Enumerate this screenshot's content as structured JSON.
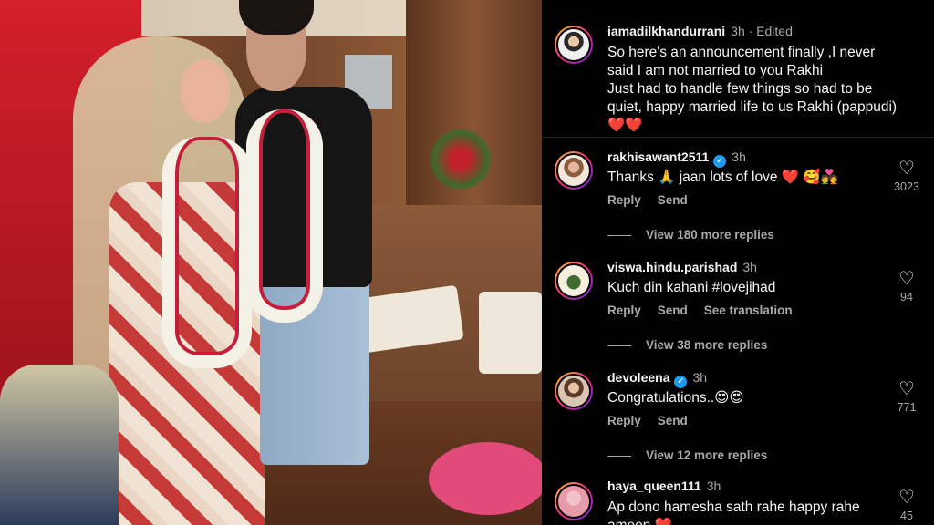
{
  "caption": {
    "username": "iamadilkhandurrani",
    "time": "3h · Edited",
    "text": "So here's an announcement finally ,I never said I am not married to you Rakhi\nJust had to handle few things so had to be quiet, happy married life to us Rakhi (pappudi) ❤️❤️"
  },
  "comments": [
    {
      "username": "rakhisawant2511",
      "verified": true,
      "time": "3h",
      "text": "Thanks 🙏 jaan lots of love ❤️ 🥰💑",
      "reply": "Reply",
      "send": "Send",
      "likes": "3023",
      "more_replies": "View 180 more replies"
    },
    {
      "username": "viswa.hindu.parishad",
      "verified": false,
      "time": "3h",
      "text": "Kuch din kahani #lovejihad",
      "reply": "Reply",
      "send": "Send",
      "translation": "See translation",
      "likes": "94",
      "more_replies": "View 38 more replies"
    },
    {
      "username": "devoleena",
      "verified": true,
      "time": "3h",
      "text": "Congratulations..😍😍",
      "reply": "Reply",
      "send": "Send",
      "likes": "771",
      "more_replies": "View 12 more replies"
    },
    {
      "username": "haya_queen111",
      "verified": false,
      "time": "3h",
      "text": "Ap dono hamesha sath rahe happy rahe ameen ❤️",
      "likes": "45"
    }
  ],
  "icons": {
    "heart": "heart-outline-icon",
    "verified": "verified-badge-icon"
  },
  "colors": {
    "background": "#000000",
    "secondary_text": "#a8a8a8",
    "verified_blue": "#1d9bf0"
  }
}
